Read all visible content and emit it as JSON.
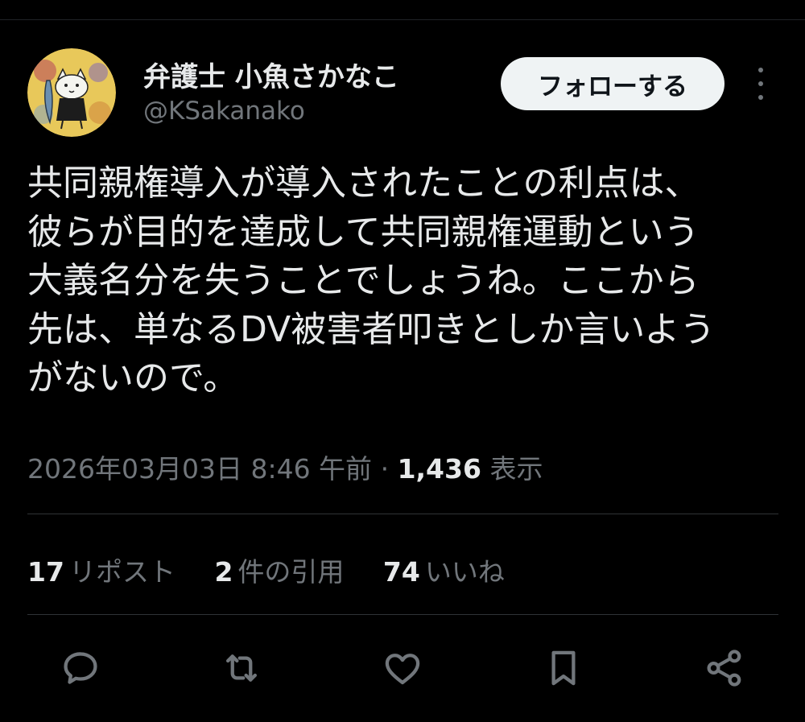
{
  "author": {
    "display_name": "弁護士 小魚さかなこ",
    "handle": "@KSakanako",
    "avatar_icon": "cat-holding-fish-avatar"
  },
  "follow_button": {
    "label": "フォローする"
  },
  "more_icon": "more-vertical-icon",
  "tweet": {
    "lines": [
      "共同親権導入が導入されたことの利点は、",
      "彼らが目的を達成して共同親権運動という",
      "大義名分を失うことでしょうね。ここから",
      "先は、単なるDV被害者叩きとしか言いよう",
      "がないので。"
    ]
  },
  "meta": {
    "timestamp": "2026年03月03日 8:46 午前",
    "separator": "·",
    "views_count": "1,436",
    "views_label": "表示"
  },
  "stats": {
    "reposts": {
      "count": "17",
      "label": "リポスト"
    },
    "quotes": {
      "count": "2",
      "label": "件の引用"
    },
    "likes": {
      "count": "74",
      "label": "いいね"
    }
  },
  "actions": [
    "reply-icon",
    "repost-icon",
    "like-icon",
    "bookmark-icon",
    "share-icon"
  ],
  "colors": {
    "background": "#000000",
    "text_primary": "#e7e9ea",
    "text_secondary": "#71767b",
    "follow_button_bg": "#eff3f4",
    "divider": "#2f3336"
  }
}
